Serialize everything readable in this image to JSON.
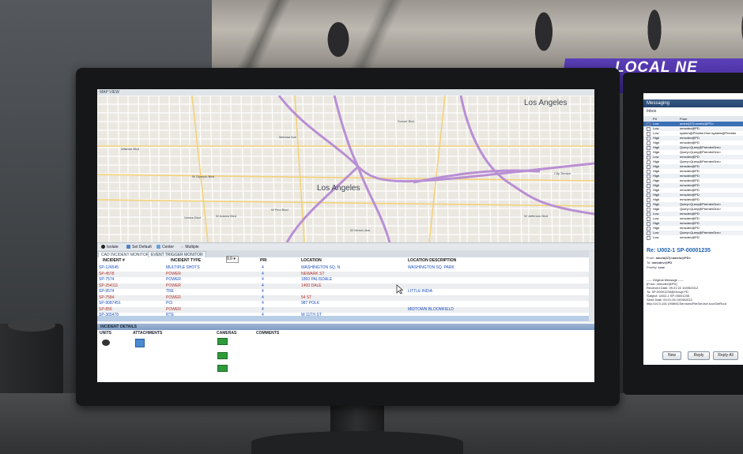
{
  "banner": {
    "text": "LOCAL NE"
  },
  "map": {
    "title": "MAP VIEW",
    "labels": [
      {
        "text": "Los Angeles",
        "size": "large"
      },
      {
        "text": "Los Angeles",
        "size": "large"
      },
      {
        "text": "Wilshire Blvd",
        "size": "small"
      },
      {
        "text": "W Olympic Blvd",
        "size": "small"
      },
      {
        "text": "W Pico Blvd",
        "size": "small"
      },
      {
        "text": "W Adams Blvd",
        "size": "small"
      },
      {
        "text": "Venice Blvd",
        "size": "small"
      },
      {
        "text": "Sunset Blvd",
        "size": "small"
      },
      {
        "text": "Melrose Ave",
        "size": "small"
      },
      {
        "text": "W Vernon Ave",
        "size": "small"
      },
      {
        "text": "W Jefferson Blvd",
        "size": "small"
      },
      {
        "text": "City Terrace",
        "size": "small"
      }
    ]
  },
  "toolbar": {
    "isolate": "Isolate",
    "set_default": "Set Default",
    "center": "Center",
    "multiple": "Multiple"
  },
  "tabs": [
    "CAD INCIDENT MONITOR",
    "EVENT TRIGGER MONITOR"
  ],
  "table": {
    "headers": {
      "incident": "INCIDENT #",
      "type": "INCIDENT TYPE",
      "filter": "0.0",
      "pri": "PRI",
      "location": "LOCATION",
      "desc": "LOCATION DESCRIPTION"
    },
    "rows": [
      {
        "id": "SP-124545",
        "type": "MULTIPLE SHOTS",
        "pri": "4",
        "location": "WASHINGTON SQ. N",
        "desc": "WASHINGTON SQ. PARK",
        "color": "blue"
      },
      {
        "id": "SP-4578",
        "type": "POWER",
        "pri": "4",
        "location": "NEWARK ST",
        "desc": "",
        "color": "red"
      },
      {
        "id": "SP-7574",
        "type": "POWER",
        "pri": "4",
        "location": "1860 PALISDALE",
        "desc": "",
        "color": "blue"
      },
      {
        "id": "SP-254111",
        "type": "POWER",
        "pri": "4",
        "location": "1400 DALE",
        "desc": "",
        "color": "red"
      },
      {
        "id": "SP-9574",
        "type": "TRE",
        "pri": "4",
        "location": "",
        "desc": "LITTLE INDIA",
        "color": "blue"
      },
      {
        "id": "SP-7584",
        "type": "POWER",
        "pri": "4",
        "location": "54 ST",
        "desc": "",
        "color": "red"
      },
      {
        "id": "SP-9087451",
        "type": "PCI",
        "pri": "4",
        "location": "987 POLK",
        "desc": "",
        "color": "blue"
      },
      {
        "id": "SP-856",
        "type": "POWER",
        "pri": "4",
        "location": "",
        "desc": "MIDTOWN BLOOMFIELD",
        "color": "red"
      },
      {
        "id": "SP-365478",
        "type": "RTE",
        "pri": "4",
        "location": "W 11TH ST",
        "desc": "",
        "color": "blue"
      }
    ]
  },
  "details": {
    "header": "INCIDENT DETAILS",
    "units": "UNITS",
    "attachments": "ATTACHMENTS",
    "cameras": "CAMERAS",
    "comments": "COMMENTS"
  },
  "messaging": {
    "title": "Messaging",
    "inbox": "Inbox",
    "columns": {
      "pri": "Pri",
      "from": "From"
    },
    "rows": [
      {
        "pri": "Low",
        "from": "amelo(37)<amelo@PD>"
      },
      {
        "pri": "Low",
        "from": "mmcdev@PD"
      },
      {
        "pri": "Low",
        "from": "system@PremierOne<system@Premier"
      },
      {
        "pri": "High",
        "from": "mmcdev@PD"
      },
      {
        "pri": "High",
        "from": "mmcdev@PD"
      },
      {
        "pri": "High",
        "from": "Query<Query@PremierOne>"
      },
      {
        "pri": "High",
        "from": "Query<Query@PremierOne>"
      },
      {
        "pri": "Low",
        "from": "mmcdev@PD"
      },
      {
        "pri": "High",
        "from": "Query<Query@PremierOne>"
      },
      {
        "pri": "High",
        "from": "mmcdev@PD"
      },
      {
        "pri": "High",
        "from": "mmcdev@PD"
      },
      {
        "pri": "High",
        "from": "mmcdev@PD"
      },
      {
        "pri": "High",
        "from": "mmcdev@PD"
      },
      {
        "pri": "High",
        "from": "mmcdev@PD"
      },
      {
        "pri": "High",
        "from": "mmcdev@PD"
      },
      {
        "pri": "High",
        "from": "mmcdev@PD"
      },
      {
        "pri": "High",
        "from": "mmcdev@PD"
      },
      {
        "pri": "High",
        "from": "Query<Query@PremierOne>"
      },
      {
        "pri": "High",
        "from": "Query<Query@PremierOne>"
      },
      {
        "pri": "Low",
        "from": "mmcdev@PD"
      },
      {
        "pri": "Low",
        "from": "mmcdev@PD"
      },
      {
        "pri": "High",
        "from": "mmcdev@PD"
      },
      {
        "pri": "High",
        "from": "mmcdev@PD"
      },
      {
        "pri": "Low",
        "from": "Query<Query@PremierOne>"
      },
      {
        "pri": "Low",
        "from": "mmcdev@PD"
      }
    ],
    "subject": "Re:  U002-1  SP-00001235",
    "from_label": "From:",
    "from_value": "amelo(37)<amelo@PD>",
    "to_label": "To:",
    "to_value": "mmcdev@PD",
    "priority_label": "Priority:",
    "priority_value": "Low",
    "body": "----- Original Message -----\n[From: mmcdev@PD]\nReceived Date: 09:21:22 10/05/2012\nTo: SP-00001235@Group.PD\nSubject: U002-1 SP-00001235\nSend Date: 09:21:26 10/05/2012\nhttp://10.0.115.19/MMCServices/FileService.svc/GetRout",
    "buttons": {
      "new": "New",
      "reply": "Reply",
      "reply_all": "Reply All"
    }
  }
}
